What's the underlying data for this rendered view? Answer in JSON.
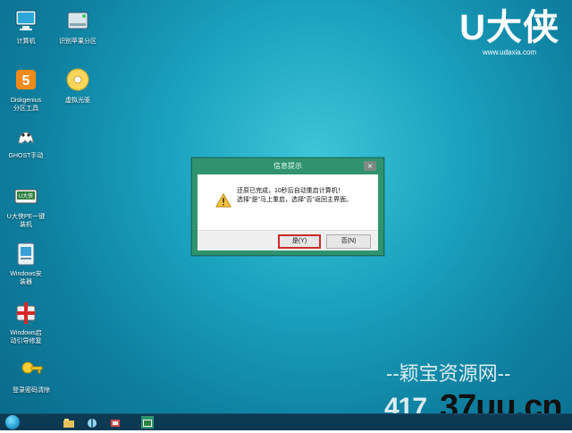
{
  "desktop": {
    "icons": [
      {
        "label": "计算机",
        "icon": "computer-icon"
      },
      {
        "label": "识别苹果分区",
        "icon": "drive-icon"
      },
      {
        "label": "Diskgenius\n分区工具",
        "icon": "diskgenius-icon"
      },
      {
        "label": "虚拟光驱",
        "icon": "cd-icon"
      },
      {
        "label": "GHOST手动",
        "icon": "ghost-icon"
      },
      {
        "label": "U大侠PE一键\n装机",
        "icon": "installer-icon"
      },
      {
        "label": "Windows安\n装器",
        "icon": "windows-installer-icon"
      },
      {
        "label": "Windows启\n动引导修复",
        "icon": "boot-repair-icon"
      },
      {
        "label": "登录密码清除",
        "icon": "key-icon"
      }
    ]
  },
  "brand": {
    "logo": "U大侠",
    "url": "www.udaxia.com"
  },
  "dialog": {
    "title": "信息提示",
    "close_label": "×",
    "message_line1": "还原已完成，10秒后自动重启计算机！",
    "message_line2": "选择\"是\"马上重启，选择\"否\"返回主界面。",
    "yes_label": "是(Y)",
    "no_label": "否(N)"
  },
  "watermark": {
    "line1": "--颖宝资源网--",
    "line2": "417",
    "line3": "37uu.cn"
  },
  "colors": {
    "dialog_title_bg": "#2f936f",
    "taskbar_bg": "#0d3a53",
    "focus_border": "#cc2a2a"
  }
}
